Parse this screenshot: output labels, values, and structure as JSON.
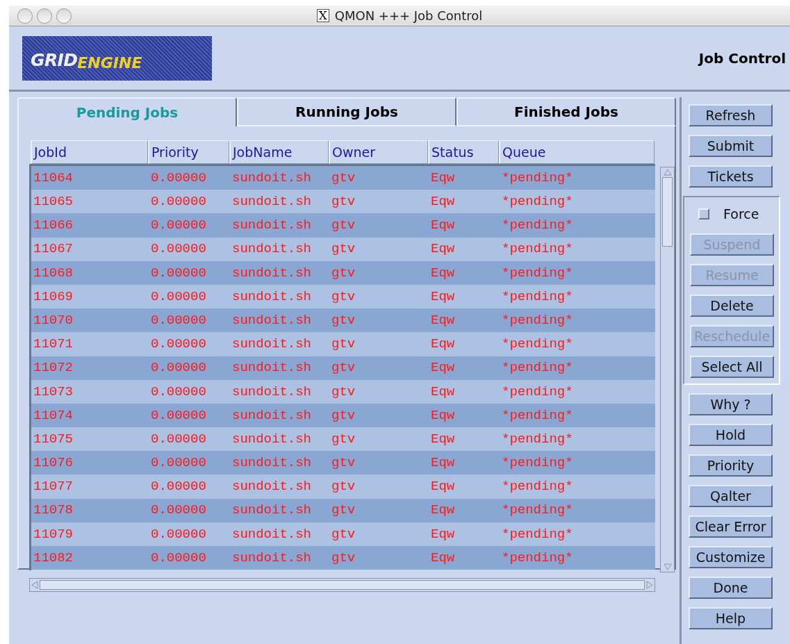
{
  "window": {
    "title": "QMON +++ Job Control",
    "title_icon": "X"
  },
  "logo": {
    "part_1": "GRID",
    "part_2": "ENGINE"
  },
  "heading": "Job Control",
  "tabs": [
    {
      "label": "Pending Jobs",
      "selected": true
    },
    {
      "label": "Running Jobs",
      "selected": false
    },
    {
      "label": "Finished Jobs",
      "selected": false
    }
  ],
  "table": {
    "columns": [
      "JobId",
      "Priority",
      "JobName",
      "Owner",
      "Status",
      "Queue"
    ],
    "rows": [
      [
        "11064",
        "0.00000",
        "sundoit.sh",
        "gtv",
        "Eqw",
        "*pending*"
      ],
      [
        "11065",
        "0.00000",
        "sundoit.sh",
        "gtv",
        "Eqw",
        "*pending*"
      ],
      [
        "11066",
        "0.00000",
        "sundoit.sh",
        "gtv",
        "Eqw",
        "*pending*"
      ],
      [
        "11067",
        "0.00000",
        "sundoit.sh",
        "gtv",
        "Eqw",
        "*pending*"
      ],
      [
        "11068",
        "0.00000",
        "sundoit.sh",
        "gtv",
        "Eqw",
        "*pending*"
      ],
      [
        "11069",
        "0.00000",
        "sundoit.sh",
        "gtv",
        "Eqw",
        "*pending*"
      ],
      [
        "11070",
        "0.00000",
        "sundoit.sh",
        "gtv",
        "Eqw",
        "*pending*"
      ],
      [
        "11071",
        "0.00000",
        "sundoit.sh",
        "gtv",
        "Eqw",
        "*pending*"
      ],
      [
        "11072",
        "0.00000",
        "sundoit.sh",
        "gtv",
        "Eqw",
        "*pending*"
      ],
      [
        "11073",
        "0.00000",
        "sundoit.sh",
        "gtv",
        "Eqw",
        "*pending*"
      ],
      [
        "11074",
        "0.00000",
        "sundoit.sh",
        "gtv",
        "Eqw",
        "*pending*"
      ],
      [
        "11075",
        "0.00000",
        "sundoit.sh",
        "gtv",
        "Eqw",
        "*pending*"
      ],
      [
        "11076",
        "0.00000",
        "sundoit.sh",
        "gtv",
        "Eqw",
        "*pending*"
      ],
      [
        "11077",
        "0.00000",
        "sundoit.sh",
        "gtv",
        "Eqw",
        "*pending*"
      ],
      [
        "11078",
        "0.00000",
        "sundoit.sh",
        "gtv",
        "Eqw",
        "*pending*"
      ],
      [
        "11079",
        "0.00000",
        "sundoit.sh",
        "gtv",
        "Eqw",
        "*pending*"
      ],
      [
        "11082",
        "0.00000",
        "sundoit.sh",
        "gtv",
        "Eqw",
        "*pending*"
      ]
    ]
  },
  "top_buttons": [
    {
      "label": "Refresh",
      "disabled": false
    },
    {
      "label": "Submit",
      "disabled": false
    },
    {
      "label": "Tickets",
      "disabled": false
    }
  ],
  "force": {
    "label": "Force",
    "checked": false
  },
  "action_buttons": [
    {
      "label": "Suspend",
      "disabled": true
    },
    {
      "label": "Resume",
      "disabled": true
    },
    {
      "label": "Delete",
      "disabled": false
    },
    {
      "label": "Reschedule",
      "disabled": true
    },
    {
      "label": "Select All",
      "disabled": false
    }
  ],
  "bottom_buttons": [
    {
      "label": "Why ?",
      "disabled": false
    },
    {
      "label": "Hold",
      "disabled": false
    },
    {
      "label": "Priority",
      "disabled": false
    },
    {
      "label": "Qalter",
      "disabled": false
    },
    {
      "label": "Clear Error",
      "disabled": false
    },
    {
      "label": "Customize",
      "disabled": false
    },
    {
      "label": "Done",
      "disabled": false
    },
    {
      "label": "Help",
      "disabled": false
    }
  ]
}
